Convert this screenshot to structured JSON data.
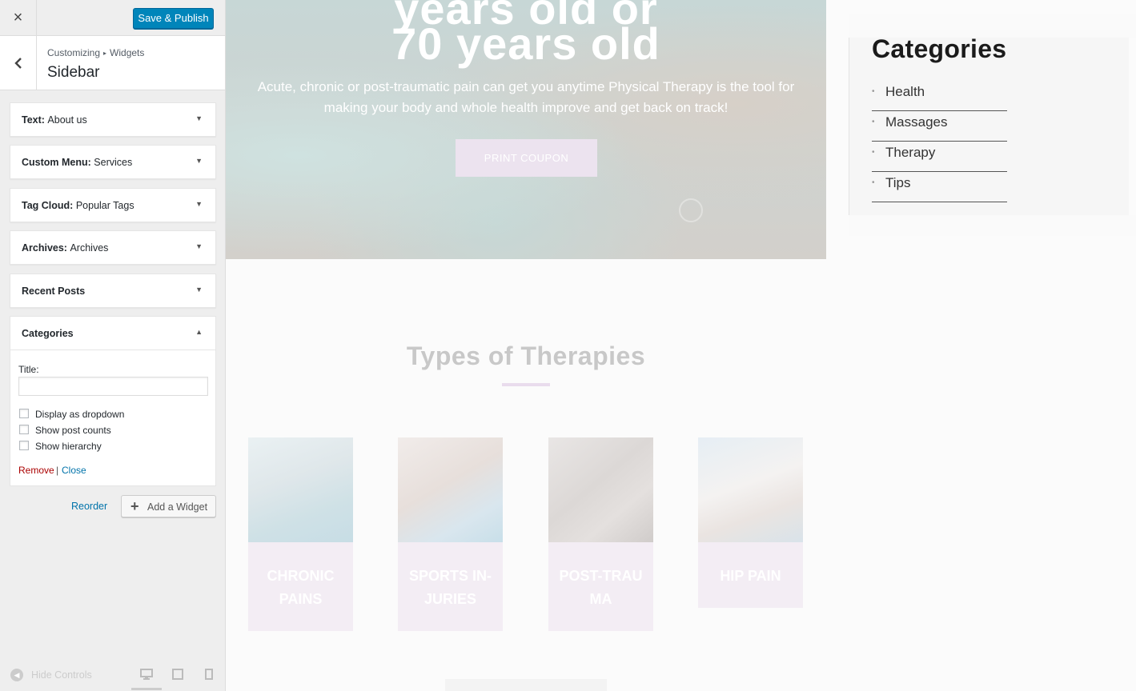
{
  "customizer": {
    "close_icon": "×",
    "save_label": "Save & Publish",
    "back_icon": "‹",
    "breadcrumb": {
      "parent": "Customizing",
      "separator": "▸",
      "current": "Widgets"
    },
    "section_title": "Sidebar",
    "widgets": [
      {
        "type": "Text:",
        "name": "About us"
      },
      {
        "type": "Custom Menu:",
        "name": "Services"
      },
      {
        "type": "Tag Cloud:",
        "name": "Popular Tags"
      },
      {
        "type": "Archives:",
        "name": "Archives"
      },
      {
        "type": "Recent Posts",
        "name": ""
      }
    ],
    "open_widget": {
      "title": "Categories",
      "title_label": "Title:",
      "title_value": "",
      "options": [
        {
          "label": "Display as dropdown",
          "checked": false
        },
        {
          "label": "Show post counts",
          "checked": false
        },
        {
          "label": "Show hierarchy",
          "checked": false
        }
      ],
      "remove_label": "Remove",
      "separator": "|",
      "close_label": "Close"
    },
    "reorder_label": "Reorder",
    "add_widget_label": "Add a Widget",
    "footer": {
      "hide_controls_label": "Hide Controls"
    },
    "colors": {
      "primary": "#0085ba",
      "link": "#0073aa",
      "danger": "#aa0000"
    }
  },
  "preview": {
    "hero": {
      "title_line1": "years old or",
      "title_line2": "70 years old",
      "text": "Acute, chronic or post-traumatic pain can get you anytime Physical Therapy is the tool for making your body and whole health improve and get back on track!",
      "button_label": "PRINT COUPON"
    },
    "therapies": {
      "title": "Types of Therapies",
      "cards": [
        {
          "label": "CHRONIC PAINS"
        },
        {
          "label": "SPORTS IN-JURIES"
        },
        {
          "label": "POST-TRAU MA"
        },
        {
          "label": "HIP PAIN"
        }
      ]
    },
    "sidebar": {
      "title": "Categories",
      "items": [
        "Health",
        "Massages",
        "Therapy",
        "Tips"
      ]
    }
  }
}
